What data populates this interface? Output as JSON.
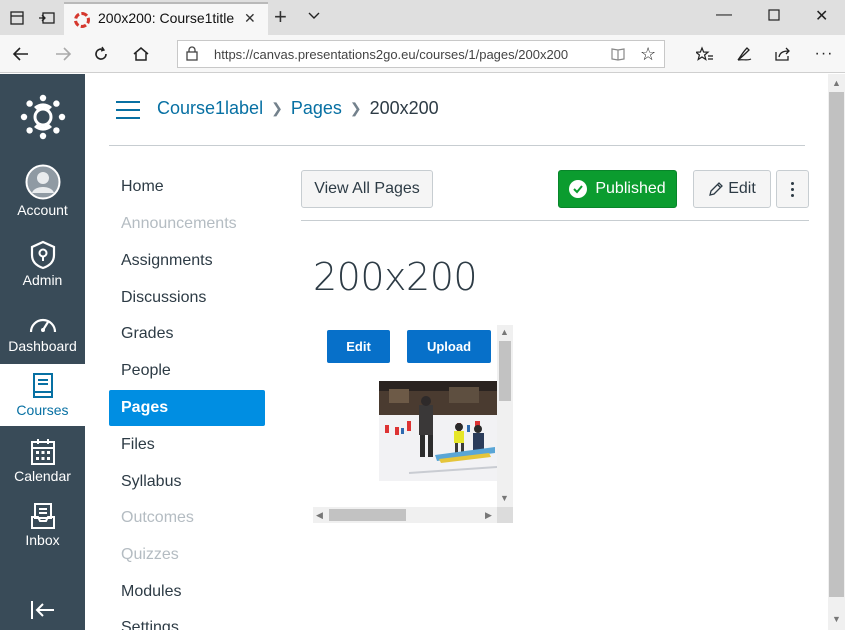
{
  "browser": {
    "tab_title": "200x200: Course1title",
    "url": "https://canvas.presentations2go.eu/courses/1/pages/200x200"
  },
  "global_nav": {
    "items": [
      {
        "label": "Account",
        "icon": "user-avatar-icon",
        "active": false
      },
      {
        "label": "Admin",
        "icon": "admin-shield-icon",
        "active": false
      },
      {
        "label": "Dashboard",
        "icon": "dashboard-gauge-icon",
        "active": false
      },
      {
        "label": "Courses",
        "icon": "book-icon",
        "active": true
      },
      {
        "label": "Calendar",
        "icon": "calendar-icon",
        "active": false
      },
      {
        "label": "Inbox",
        "icon": "inbox-icon",
        "active": false
      }
    ]
  },
  "breadcrumb": {
    "items": [
      "Course1label",
      "Pages",
      "200x200"
    ]
  },
  "course_nav": {
    "items": [
      {
        "label": "Home",
        "state": "normal"
      },
      {
        "label": "Announcements",
        "state": "disabled"
      },
      {
        "label": "Assignments",
        "state": "normal"
      },
      {
        "label": "Discussions",
        "state": "normal"
      },
      {
        "label": "Grades",
        "state": "normal"
      },
      {
        "label": "People",
        "state": "normal"
      },
      {
        "label": "Pages",
        "state": "active"
      },
      {
        "label": "Files",
        "state": "normal"
      },
      {
        "label": "Syllabus",
        "state": "normal"
      },
      {
        "label": "Outcomes",
        "state": "disabled"
      },
      {
        "label": "Quizzes",
        "state": "disabled"
      },
      {
        "label": "Modules",
        "state": "normal"
      },
      {
        "label": "Settings",
        "state": "normal"
      }
    ]
  },
  "toolbar": {
    "view_all_label": "View All Pages",
    "published_label": "Published",
    "edit_label": "Edit"
  },
  "page": {
    "title": "200x200"
  },
  "embed": {
    "edit_label": "Edit",
    "upload_label": "Upload"
  },
  "colors": {
    "global_nav_bg": "#394b58",
    "accent": "#0770a3",
    "active_nav": "#008ee2",
    "published": "#0b9c2f"
  }
}
